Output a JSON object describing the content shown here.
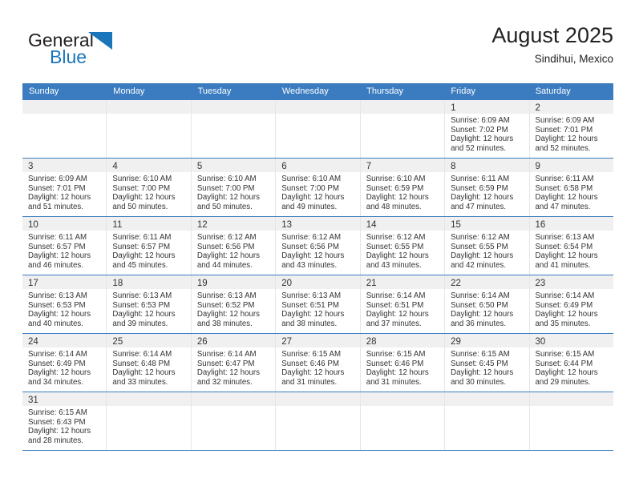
{
  "brand": {
    "line1": "General",
    "line2": "Blue",
    "mark": "blue-triangle-logo-mark"
  },
  "header": {
    "title": "August 2025",
    "subtitle": "Sindihui, Mexico"
  },
  "colors": {
    "header_blue": "#3b7cc0",
    "brand_blue": "#1b75bb",
    "day_bar_gray": "#f0f0f0",
    "text": "#333333"
  },
  "weekday_headers": [
    "Sunday",
    "Monday",
    "Tuesday",
    "Wednesday",
    "Thursday",
    "Friday",
    "Saturday"
  ],
  "labels": {
    "sunrise": "Sunrise:",
    "sunset": "Sunset:",
    "daylight": "Daylight:"
  },
  "weeks": [
    [
      {
        "day": "",
        "sunrise": "",
        "sunset": "",
        "daylight_line1": "",
        "daylight_line2": ""
      },
      {
        "day": "",
        "sunrise": "",
        "sunset": "",
        "daylight_line1": "",
        "daylight_line2": ""
      },
      {
        "day": "",
        "sunrise": "",
        "sunset": "",
        "daylight_line1": "",
        "daylight_line2": ""
      },
      {
        "day": "",
        "sunrise": "",
        "sunset": "",
        "daylight_line1": "",
        "daylight_line2": ""
      },
      {
        "day": "",
        "sunrise": "",
        "sunset": "",
        "daylight_line1": "",
        "daylight_line2": ""
      },
      {
        "day": "1",
        "sunrise": "Sunrise: 6:09 AM",
        "sunset": "Sunset: 7:02 PM",
        "daylight_line1": "Daylight: 12 hours",
        "daylight_line2": "and 52 minutes."
      },
      {
        "day": "2",
        "sunrise": "Sunrise: 6:09 AM",
        "sunset": "Sunset: 7:01 PM",
        "daylight_line1": "Daylight: 12 hours",
        "daylight_line2": "and 52 minutes."
      }
    ],
    [
      {
        "day": "3",
        "sunrise": "Sunrise: 6:09 AM",
        "sunset": "Sunset: 7:01 PM",
        "daylight_line1": "Daylight: 12 hours",
        "daylight_line2": "and 51 minutes."
      },
      {
        "day": "4",
        "sunrise": "Sunrise: 6:10 AM",
        "sunset": "Sunset: 7:00 PM",
        "daylight_line1": "Daylight: 12 hours",
        "daylight_line2": "and 50 minutes."
      },
      {
        "day": "5",
        "sunrise": "Sunrise: 6:10 AM",
        "sunset": "Sunset: 7:00 PM",
        "daylight_line1": "Daylight: 12 hours",
        "daylight_line2": "and 50 minutes."
      },
      {
        "day": "6",
        "sunrise": "Sunrise: 6:10 AM",
        "sunset": "Sunset: 7:00 PM",
        "daylight_line1": "Daylight: 12 hours",
        "daylight_line2": "and 49 minutes."
      },
      {
        "day": "7",
        "sunrise": "Sunrise: 6:10 AM",
        "sunset": "Sunset: 6:59 PM",
        "daylight_line1": "Daylight: 12 hours",
        "daylight_line2": "and 48 minutes."
      },
      {
        "day": "8",
        "sunrise": "Sunrise: 6:11 AM",
        "sunset": "Sunset: 6:59 PM",
        "daylight_line1": "Daylight: 12 hours",
        "daylight_line2": "and 47 minutes."
      },
      {
        "day": "9",
        "sunrise": "Sunrise: 6:11 AM",
        "sunset": "Sunset: 6:58 PM",
        "daylight_line1": "Daylight: 12 hours",
        "daylight_line2": "and 47 minutes."
      }
    ],
    [
      {
        "day": "10",
        "sunrise": "Sunrise: 6:11 AM",
        "sunset": "Sunset: 6:57 PM",
        "daylight_line1": "Daylight: 12 hours",
        "daylight_line2": "and 46 minutes."
      },
      {
        "day": "11",
        "sunrise": "Sunrise: 6:11 AM",
        "sunset": "Sunset: 6:57 PM",
        "daylight_line1": "Daylight: 12 hours",
        "daylight_line2": "and 45 minutes."
      },
      {
        "day": "12",
        "sunrise": "Sunrise: 6:12 AM",
        "sunset": "Sunset: 6:56 PM",
        "daylight_line1": "Daylight: 12 hours",
        "daylight_line2": "and 44 minutes."
      },
      {
        "day": "13",
        "sunrise": "Sunrise: 6:12 AM",
        "sunset": "Sunset: 6:56 PM",
        "daylight_line1": "Daylight: 12 hours",
        "daylight_line2": "and 43 minutes."
      },
      {
        "day": "14",
        "sunrise": "Sunrise: 6:12 AM",
        "sunset": "Sunset: 6:55 PM",
        "daylight_line1": "Daylight: 12 hours",
        "daylight_line2": "and 43 minutes."
      },
      {
        "day": "15",
        "sunrise": "Sunrise: 6:12 AM",
        "sunset": "Sunset: 6:55 PM",
        "daylight_line1": "Daylight: 12 hours",
        "daylight_line2": "and 42 minutes."
      },
      {
        "day": "16",
        "sunrise": "Sunrise: 6:13 AM",
        "sunset": "Sunset: 6:54 PM",
        "daylight_line1": "Daylight: 12 hours",
        "daylight_line2": "and 41 minutes."
      }
    ],
    [
      {
        "day": "17",
        "sunrise": "Sunrise: 6:13 AM",
        "sunset": "Sunset: 6:53 PM",
        "daylight_line1": "Daylight: 12 hours",
        "daylight_line2": "and 40 minutes."
      },
      {
        "day": "18",
        "sunrise": "Sunrise: 6:13 AM",
        "sunset": "Sunset: 6:53 PM",
        "daylight_line1": "Daylight: 12 hours",
        "daylight_line2": "and 39 minutes."
      },
      {
        "day": "19",
        "sunrise": "Sunrise: 6:13 AM",
        "sunset": "Sunset: 6:52 PM",
        "daylight_line1": "Daylight: 12 hours",
        "daylight_line2": "and 38 minutes."
      },
      {
        "day": "20",
        "sunrise": "Sunrise: 6:13 AM",
        "sunset": "Sunset: 6:51 PM",
        "daylight_line1": "Daylight: 12 hours",
        "daylight_line2": "and 38 minutes."
      },
      {
        "day": "21",
        "sunrise": "Sunrise: 6:14 AM",
        "sunset": "Sunset: 6:51 PM",
        "daylight_line1": "Daylight: 12 hours",
        "daylight_line2": "and 37 minutes."
      },
      {
        "day": "22",
        "sunrise": "Sunrise: 6:14 AM",
        "sunset": "Sunset: 6:50 PM",
        "daylight_line1": "Daylight: 12 hours",
        "daylight_line2": "and 36 minutes."
      },
      {
        "day": "23",
        "sunrise": "Sunrise: 6:14 AM",
        "sunset": "Sunset: 6:49 PM",
        "daylight_line1": "Daylight: 12 hours",
        "daylight_line2": "and 35 minutes."
      }
    ],
    [
      {
        "day": "24",
        "sunrise": "Sunrise: 6:14 AM",
        "sunset": "Sunset: 6:49 PM",
        "daylight_line1": "Daylight: 12 hours",
        "daylight_line2": "and 34 minutes."
      },
      {
        "day": "25",
        "sunrise": "Sunrise: 6:14 AM",
        "sunset": "Sunset: 6:48 PM",
        "daylight_line1": "Daylight: 12 hours",
        "daylight_line2": "and 33 minutes."
      },
      {
        "day": "26",
        "sunrise": "Sunrise: 6:14 AM",
        "sunset": "Sunset: 6:47 PM",
        "daylight_line1": "Daylight: 12 hours",
        "daylight_line2": "and 32 minutes."
      },
      {
        "day": "27",
        "sunrise": "Sunrise: 6:15 AM",
        "sunset": "Sunset: 6:46 PM",
        "daylight_line1": "Daylight: 12 hours",
        "daylight_line2": "and 31 minutes."
      },
      {
        "day": "28",
        "sunrise": "Sunrise: 6:15 AM",
        "sunset": "Sunset: 6:46 PM",
        "daylight_line1": "Daylight: 12 hours",
        "daylight_line2": "and 31 minutes."
      },
      {
        "day": "29",
        "sunrise": "Sunrise: 6:15 AM",
        "sunset": "Sunset: 6:45 PM",
        "daylight_line1": "Daylight: 12 hours",
        "daylight_line2": "and 30 minutes."
      },
      {
        "day": "30",
        "sunrise": "Sunrise: 6:15 AM",
        "sunset": "Sunset: 6:44 PM",
        "daylight_line1": "Daylight: 12 hours",
        "daylight_line2": "and 29 minutes."
      }
    ],
    [
      {
        "day": "31",
        "sunrise": "Sunrise: 6:15 AM",
        "sunset": "Sunset: 6:43 PM",
        "daylight_line1": "Daylight: 12 hours",
        "daylight_line2": "and 28 minutes."
      },
      {
        "day": "",
        "sunrise": "",
        "sunset": "",
        "daylight_line1": "",
        "daylight_line2": ""
      },
      {
        "day": "",
        "sunrise": "",
        "sunset": "",
        "daylight_line1": "",
        "daylight_line2": ""
      },
      {
        "day": "",
        "sunrise": "",
        "sunset": "",
        "daylight_line1": "",
        "daylight_line2": ""
      },
      {
        "day": "",
        "sunrise": "",
        "sunset": "",
        "daylight_line1": "",
        "daylight_line2": ""
      },
      {
        "day": "",
        "sunrise": "",
        "sunset": "",
        "daylight_line1": "",
        "daylight_line2": ""
      },
      {
        "day": "",
        "sunrise": "",
        "sunset": "",
        "daylight_line1": "",
        "daylight_line2": ""
      }
    ]
  ]
}
